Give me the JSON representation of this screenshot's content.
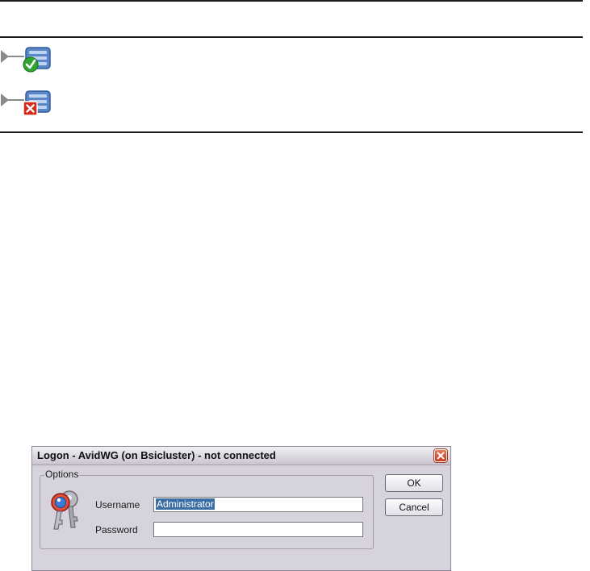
{
  "status_table": {
    "rows": [
      {
        "status": "connected",
        "icon": "server-connected-icon"
      },
      {
        "status": "disconnected",
        "icon": "server-disconnected-icon"
      }
    ]
  },
  "dialog": {
    "title": "Logon - AvidWG (on Bsicluster)  - not connected",
    "close_icon": "close-icon",
    "group_label": "Options",
    "icon": "keys-icon",
    "username_label": "Username",
    "username_value": "Administrator",
    "password_label": "Password",
    "password_value": "",
    "ok_label": "OK",
    "cancel_label": "Cancel"
  },
  "colors": {
    "selection": "#3a6ea5",
    "close_button": "#c8391a",
    "dialog_background": "#d7d3dc",
    "ok_check": "#2fa62f",
    "error_x": "#d42a1a"
  }
}
